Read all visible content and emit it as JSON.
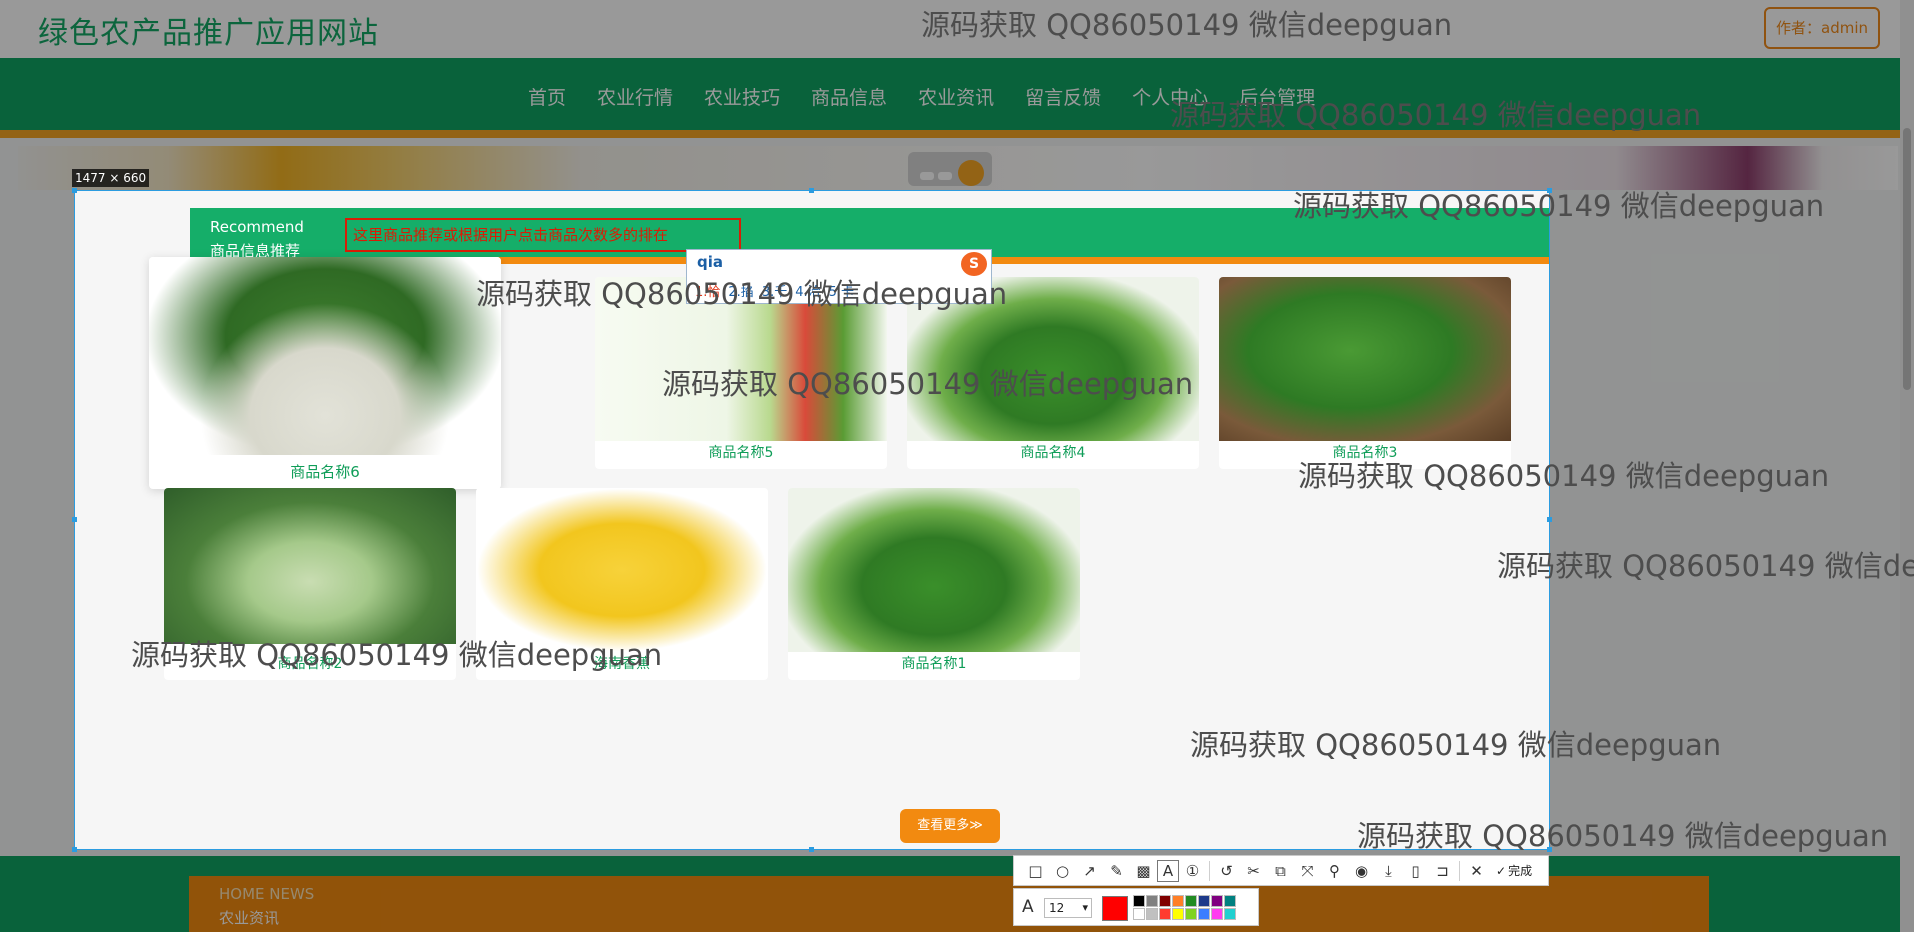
{
  "site": {
    "title": "绿色农产品推广应用网站",
    "author_label": "作者：admin"
  },
  "nav": {
    "items": [
      {
        "label": "首页"
      },
      {
        "label": "农业行情"
      },
      {
        "label": "农业技巧"
      },
      {
        "label": "商品信息"
      },
      {
        "label": "农业资讯"
      },
      {
        "label": "留言反馈"
      },
      {
        "label": "个人中心"
      },
      {
        "label": "后台管理"
      }
    ]
  },
  "capture": {
    "size_label": "1477 × 660"
  },
  "recommend": {
    "title_en": "Recommend",
    "title_cn": "商品信息推荐",
    "note": "这里商品推荐或根据用户点击商品次数多的排在",
    "more_button": "查看更多≫",
    "products": [
      {
        "name": "商品名称6",
        "image": "pak-choi"
      },
      {
        "name": "商品名称5",
        "image": "vegetable-poster"
      },
      {
        "name": "商品名称4",
        "image": "green-vegetables"
      },
      {
        "name": "商品名称3",
        "image": "broccoli"
      },
      {
        "name": "商品名称2",
        "image": "gourds"
      },
      {
        "name": "海南香蕉",
        "image": "bananas"
      },
      {
        "name": "商品名称1",
        "image": "green-vegetables"
      }
    ]
  },
  "ime": {
    "input": "qia",
    "logo": "S",
    "candidates": [
      "1.恰",
      "2.掐",
      "3.千",
      "4.洽",
      "5.卡"
    ]
  },
  "footer": {
    "title": "HOME NEWS",
    "subtitle": "农业资讯"
  },
  "annotation_toolbar": {
    "tools": [
      "rectangle-icon",
      "ellipse-icon",
      "arrow-icon",
      "pencil-icon",
      "mosaic-icon",
      "text-icon",
      "number-icon",
      "undo-icon",
      "scissors-icon",
      "ocr-icon",
      "pin-icon",
      "record-icon",
      "download-icon",
      "phone-icon",
      "bookmark-icon",
      "close-icon",
      "check-icon"
    ],
    "done_label": "完成",
    "font_size": "12",
    "current_color": "#ff0000",
    "palette": [
      "#000000",
      "#808080",
      "#800000",
      "#ff7f27",
      "#228b22",
      "#1e3a8a",
      "#800080",
      "#008080",
      "#ffffff",
      "#c0c0c0",
      "#ff3b30",
      "#ffff00",
      "#7fd321",
      "#3a7dff",
      "#ff3bf0",
      "#20d0d0"
    ]
  },
  "watermark": {
    "text": "源码获取 QQ86050149 微信deepguan"
  },
  "colors": {
    "brand_green": "#15ae69",
    "accent_orange": "#f28a10",
    "selection_blue": "#2b9ce0"
  }
}
